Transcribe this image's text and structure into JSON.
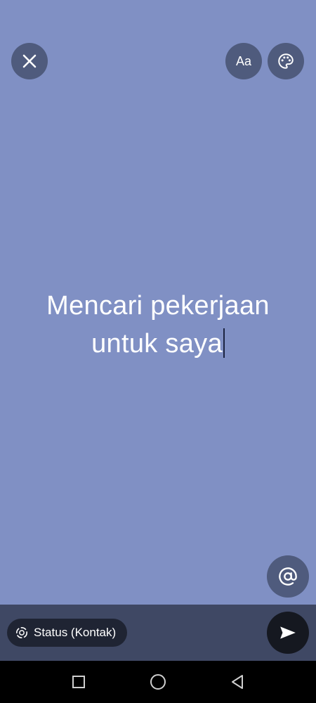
{
  "toolbar": {
    "font_button_label": "Aa"
  },
  "status": {
    "line1": "Mencari pekerjaan",
    "line2": "untuk saya"
  },
  "footer": {
    "audience_label": "Status (Kontak)"
  },
  "colors": {
    "background": "#8090c4",
    "button": "#4f5b7d",
    "bottom_bar": "#3f4864"
  },
  "icons": [
    "close-icon",
    "palette-icon",
    "at-icon",
    "status-ring-icon",
    "send-icon",
    "square-icon",
    "circle-icon",
    "triangle-back-icon"
  ]
}
